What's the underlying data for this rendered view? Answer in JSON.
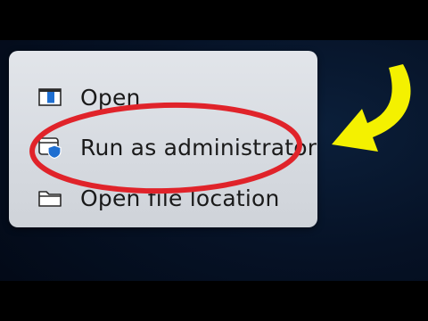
{
  "context_menu": {
    "items": [
      {
        "label": "Open",
        "icon": "open-app-icon"
      },
      {
        "label": "Run as administrator",
        "icon": "shield-window-icon"
      },
      {
        "label": "Open file location",
        "icon": "folder-icon"
      }
    ]
  },
  "annotations": {
    "highlight_color": "#e0232a",
    "arrow_color": "#f4f100"
  },
  "colors": {
    "menu_background": "#dadde2",
    "text": "#1a1a1a",
    "icon_blue": "#1f6fd1",
    "background": "#061226"
  }
}
